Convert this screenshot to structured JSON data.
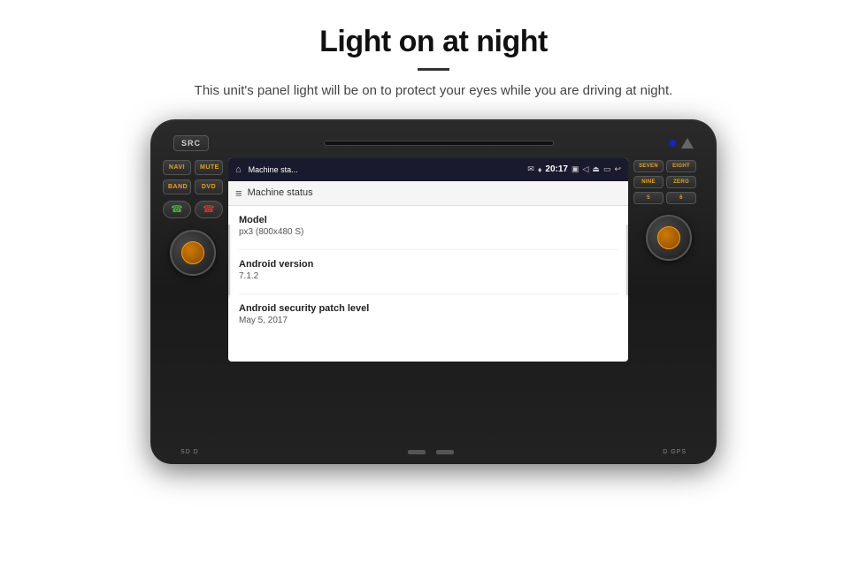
{
  "page": {
    "title": "Light on at night",
    "subtitle": "This unit's panel light will be on to protect your eyes while you are driving at night."
  },
  "stereo": {
    "buttons": {
      "src": "SRC",
      "navi": "NAVI",
      "mute": "MUTE",
      "band": "BAND",
      "dvd": "DVD",
      "seven": "SEVEN",
      "eight": "EIGHT",
      "nine": "NINE",
      "zero": "ZERO"
    }
  },
  "android": {
    "statusbar": {
      "app_name": "Machine sta...",
      "time": "20:17"
    },
    "toolbar": {
      "title": "Machine status"
    },
    "items": [
      {
        "label": "Model",
        "value": "px3 (800x480 S)"
      },
      {
        "label": "Android version",
        "value": "7.1.2"
      },
      {
        "label": "Android security patch level",
        "value": "May 5, 2017"
      }
    ]
  }
}
